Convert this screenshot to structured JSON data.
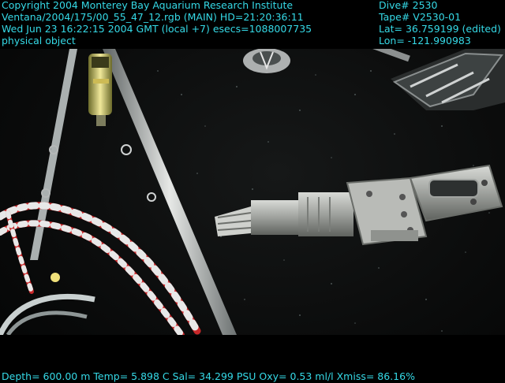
{
  "overlay": {
    "left_lines": [
      "Copyright 2004 Monterey Bay Aquarium Research Institute",
      "Ventana/2004/175/00_55_47_12.rgb (MAIN)  HD=21:20:36:11",
      "Wed Jun 23 16:22:15 2004 GMT (local +7)  esecs=1088007735",
      "physical object"
    ],
    "right_lines": [
      "Dive# 2530",
      "Tape# V2530-01",
      "Lat= 36.759199 (edited)",
      "Lon= -121.990983"
    ],
    "bottom_line": "Depth= 600.00 m  Temp= 5.898 C  Sal= 34.299 PSU  Oxy= 0.53 ml/l  Xmiss= 86.16%"
  },
  "colors": {
    "overlay_text": "#35d9e6",
    "water": "#0b0c0c",
    "rope_red": "#c8282a",
    "rope_white": "#e8e8e8",
    "metal": "#a7a9a6"
  },
  "scene_objects": [
    "robotic-manipulator-arm",
    "ocean-water-background",
    "red-white-rope",
    "white-support-pole",
    "sample-container",
    "vehicle-frame-corner",
    "suspended-particles"
  ]
}
